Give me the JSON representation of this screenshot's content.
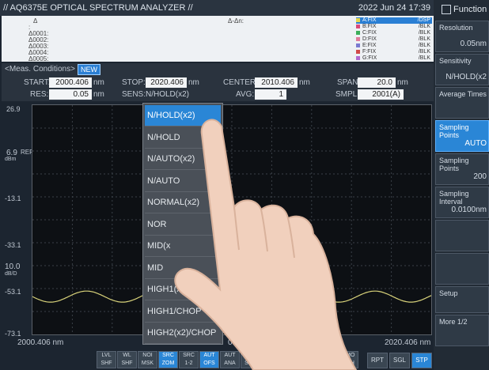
{
  "title": "// AQ6375E OPTICAL SPECTRUM ANALYZER //",
  "datetime": "2022 Jun 24 17:39",
  "markers": {
    "delta_label": "Δ",
    "delta_dn": "Δ-Δn:",
    "lines": [
      ":",
      "Δ0001:",
      "Δ0002:",
      "Δ0003:",
      "Δ0004:",
      "Δ0005:"
    ]
  },
  "traces": [
    {
      "label": "A:FIX",
      "mode": "/DSP",
      "color": "#e6d84a",
      "selected": true
    },
    {
      "label": "B:FIX",
      "mode": "/BLK",
      "color": "#d94a7a",
      "selected": false
    },
    {
      "label": "C:FIX",
      "mode": "/BLK",
      "color": "#3cae5a",
      "selected": false
    },
    {
      "label": "D:FIX",
      "mode": "/BLK",
      "color": "#e07a9a",
      "selected": false
    },
    {
      "label": "E:FIX",
      "mode": "/BLK",
      "color": "#7a7ad0",
      "selected": false
    },
    {
      "label": "F:FIX",
      "mode": "/BLK",
      "color": "#d04a4a",
      "selected": false
    },
    {
      "label": "G:FIX",
      "mode": "/BLK",
      "color": "#b06ad0",
      "selected": false
    }
  ],
  "meas": {
    "header": "<Meas. Conditions>",
    "new_badge": "NEW",
    "start_label": "START:",
    "start_value": "2000.406",
    "start_unit": "nm",
    "stop_label": "STOP:",
    "stop_value": "2020.406",
    "stop_unit": "nm",
    "center_label": "CENTER:",
    "center_value": "2010.406",
    "center_unit": "nm",
    "span_label": "SPAN:",
    "span_value": "20.0",
    "span_unit": "nm",
    "res_label": "RES:",
    "res_value": "0.05",
    "res_unit": "nm",
    "sens_label": "SENS:",
    "sens_value": "N/HOLD(x2)",
    "avg_label": "AVG:",
    "avg_value": "1",
    "smpl_label": "SMPL:",
    "smpl_value": "2001(A)"
  },
  "graph": {
    "y_top": "26.9",
    "ref_value": "6.9",
    "ref_label": "REF",
    "ref_unit": "dBm",
    "y_labels": [
      "-13.1",
      "-33.1",
      "-53.1",
      "-73.1"
    ],
    "scale_value": "10.0",
    "scale_unit": "dB/D",
    "x_start": "2000.406 nm",
    "x_mid": "06 nm",
    "x_end": "2020.406 nm",
    "trace_color": "#d8d27a"
  },
  "sens_options": [
    "N/HOLD(x2)",
    "N/HOLD",
    "N/AUTO(x2)",
    "N/AUTO",
    "NORMAL(x2)",
    "NOR",
    "MID(x",
    "MID",
    "HIGH1(x2)/C",
    "HIGH1/CHOP",
    "HIGH2(x2)/CHOP"
  ],
  "sens_selected": "N/HOLD(x2)",
  "function_panel": {
    "title": "Function",
    "buttons": [
      {
        "title": "Resolution",
        "value": "0.05nm",
        "active": false
      },
      {
        "title": "Sensitivity",
        "value": "N/HOLD(x2",
        "active": false
      },
      {
        "title": "Average Times",
        "value": "",
        "active": false
      },
      {
        "title": "Sampling Points",
        "value": "AUTO",
        "active": true
      },
      {
        "title": "Sampling Points",
        "value": "200",
        "active": false
      },
      {
        "title": "Sampling Interval",
        "value": "0.0100nm",
        "active": false
      },
      {
        "title": "",
        "value": "",
        "active": false
      },
      {
        "title": "",
        "value": "",
        "active": false
      },
      {
        "title": "Setup",
        "value": "",
        "active": false
      },
      {
        "title": "More 1/2",
        "value": "",
        "active": false
      }
    ]
  },
  "softkeys": [
    {
      "l1": "LVL",
      "l2": "SHF",
      "active": false
    },
    {
      "l1": "WL",
      "l2": "SHF",
      "active": false
    },
    {
      "l1": "NOI",
      "l2": "MSK",
      "active": false
    },
    {
      "l1": "SRC",
      "l2": "ZOM",
      "active": true
    },
    {
      "l1": "SRC",
      "l2": "1-2",
      "active": false
    },
    {
      "l1": "AUT",
      "l2": "OFS",
      "active": true
    },
    {
      "l1": "AUT",
      "l2": "ANA",
      "active": false
    },
    {
      "l1": "AU",
      "l2": "SRC",
      "active": false
    }
  ],
  "smo_key": {
    "l1": "SMO",
    "l2": "OTH"
  },
  "sweep_keys": [
    {
      "label": "RPT",
      "active": false
    },
    {
      "label": "SGL",
      "active": false
    },
    {
      "label": "STP",
      "active": true
    }
  ]
}
